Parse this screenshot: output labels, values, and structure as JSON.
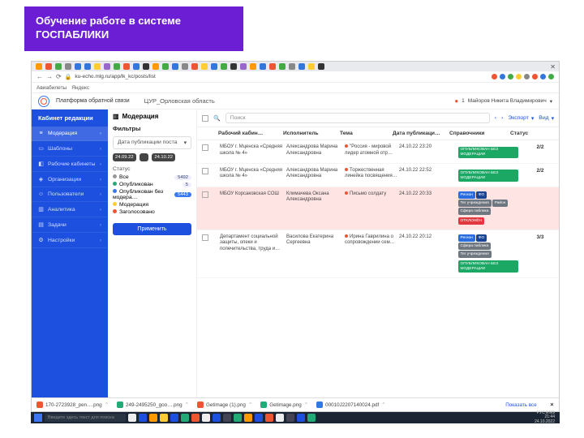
{
  "banner": {
    "line1": "Обучение работе в системе",
    "line2": "ГОСПАБЛИКИ"
  },
  "browser": {
    "url": "ku-echo.mlg.ru/app/lk_kc/posts/list",
    "bookmarks": {
      "b1": "Авиабилеты",
      "b2": "Яндекс"
    }
  },
  "platform": {
    "logo_text": "Платформа обратной связи",
    "breadcrumb": "ЦУР_Орловская область",
    "user_name": "Майоров Никита Владимирович",
    "notif_count": "1"
  },
  "sidebar": {
    "header": "Кабинет редакции",
    "items": [
      {
        "icon": "≡",
        "label": "Модерация"
      },
      {
        "icon": "▭",
        "label": "Шаблоны"
      },
      {
        "icon": "◧",
        "label": "Рабочие кабинеты"
      },
      {
        "icon": "◈",
        "label": "Организации"
      },
      {
        "icon": "☺",
        "label": "Пользователи"
      },
      {
        "icon": "▥",
        "label": "Аналитика"
      },
      {
        "icon": "▤",
        "label": "Задачи"
      },
      {
        "icon": "⚙",
        "label": "Настройки"
      }
    ]
  },
  "filters": {
    "tab": "Модерация",
    "heading": "Фильтры",
    "date_label": "Дата публикации поста",
    "date_from": "24.09.22",
    "date_to": "24.10.22",
    "status_label": "Статус",
    "statuses": [
      {
        "dot": "gr",
        "label": "Все",
        "count": "5492"
      },
      {
        "dot": "b",
        "label": "Опубликован",
        "count": "5"
      },
      {
        "dot": "g",
        "label": "Опубликован без модера…",
        "count": "5443",
        "hl": true
      },
      {
        "dot": "y",
        "label": "Модерация",
        "count": ""
      },
      {
        "dot": "r",
        "label": "Заголосовано",
        "count": ""
      }
    ],
    "apply": "Применить"
  },
  "table": {
    "search_placeholder": "Поиск",
    "nav_prev": "‹",
    "nav_next": "›",
    "export": "Экспорт",
    "view": "Вид",
    "cols": {
      "c1": "Рабочий кабин…",
      "c2": "Исполнитель",
      "c3": "Тема",
      "c4": "Дата публикаци…",
      "c5": "Справочники",
      "c6": "Статус"
    },
    "rows": [
      {
        "org": "МБОУ г. Мценска «Средняя школа № 4»",
        "person": "Александрова Марина Александровна",
        "topic": "\"Россия - мировой лидер атомной отр…",
        "date": "24.10.22 23:20",
        "tags": [],
        "status": [
          {
            "cls": "p-green",
            "t": "ОПУБЛИКОВАН БЕЗ МОДЕРАЦИИ"
          }
        ],
        "ratio": "2/2"
      },
      {
        "org": "МБОУ г. Мценска «Средняя школа № 4»",
        "person": "Александрова Марина Александровна",
        "topic": "Торжественная линейка посвящения…",
        "date": "24.10.22 22:52",
        "tags": [],
        "status": [
          {
            "cls": "p-green",
            "t": "ОПУБЛИКОВАН БЕЗ МОДЕРАЦИИ"
          }
        ],
        "ratio": "2/2"
      },
      {
        "org": "МБОУ Корсаковская СОШ",
        "person": "Климачева Оксана Александровна",
        "topic": "Письмо солдату",
        "date": "24.10.22 20:33",
        "tags": [
          {
            "cls": "p-blue",
            "t": "Регион"
          },
          {
            "cls": "p-darkblue",
            "t": "ФО"
          },
          {
            "cls": "p-grey",
            "t": "Тег учреждения"
          },
          {
            "cls": "p-grey",
            "t": "Район"
          },
          {
            "cls": "p-grey",
            "t": "Сфера паблика"
          }
        ],
        "status": [
          {
            "cls": "p-red",
            "t": "ОТКЛОНЁН"
          }
        ],
        "ratio": "",
        "rej": true
      },
      {
        "org": "Департамент социальной защиты, опеки и попечительства, труда и…",
        "person": "Василова Екатерина Сергеевна",
        "topic": "Ирина Гаврилина о сопровождении сем…",
        "date": "24.10.22 20:12",
        "tags": [
          {
            "cls": "p-blue",
            "t": "Регион"
          },
          {
            "cls": "p-darkblue",
            "t": "ФО"
          },
          {
            "cls": "p-grey",
            "t": "Сфера паблика"
          },
          {
            "cls": "p-grey",
            "t": "Тег учреждения"
          }
        ],
        "status": [
          {
            "cls": "p-green",
            "t": "ОПУБЛИКОВАН БЕЗ МОДЕРАЦИИ"
          }
        ],
        "ratio": "3/3"
      }
    ]
  },
  "downloads": {
    "items": [
      "170-2723928_pen….png",
      "249-2495250_goo….png",
      "Getimage (1).png",
      "Getimage.png",
      "00010J2207140024.pdf"
    ],
    "show_all": "Показать все"
  },
  "taskbar": {
    "search_ph": "Введите здесь текст для поиска",
    "lang": "РУС  ENG",
    "time": "21:44",
    "date": "24.10.2022"
  }
}
